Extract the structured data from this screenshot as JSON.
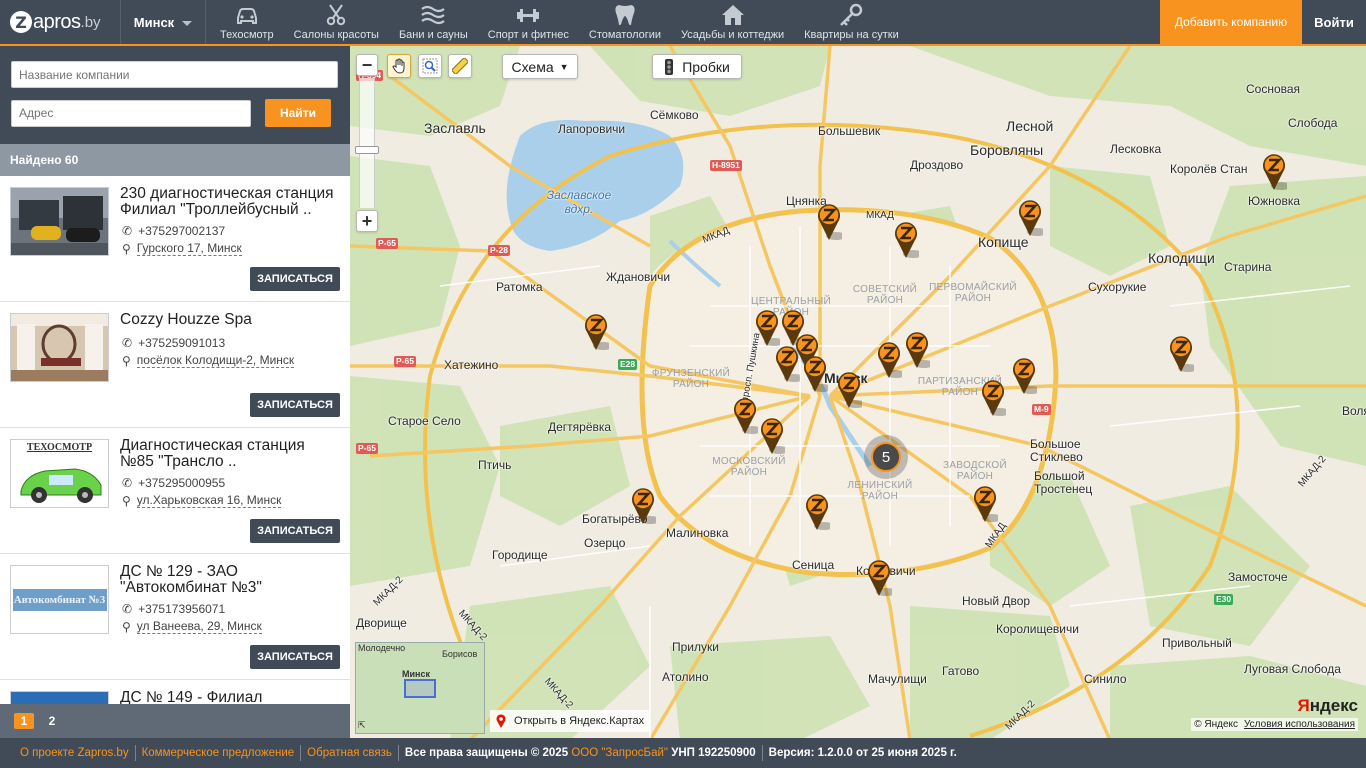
{
  "header": {
    "logo_text": "apros",
    "logo_letter": "Z",
    "logo_suffix": ".by",
    "city": "Минск",
    "categories": [
      {
        "label": "Техосмотр",
        "icon": "car-icon"
      },
      {
        "label": "Салоны красоты",
        "icon": "scissors-icon"
      },
      {
        "label": "Бани и сауны",
        "icon": "steam-icon"
      },
      {
        "label": "Спорт и фитнес",
        "icon": "dumbbell-icon"
      },
      {
        "label": "Стоматологии",
        "icon": "tooth-icon"
      },
      {
        "label": "Усадьбы и коттеджи",
        "icon": "house-icon"
      },
      {
        "label": "Квартиры на сутки",
        "icon": "key-icon"
      }
    ],
    "add_company": "Добавить компанию",
    "login": "Войти"
  },
  "search": {
    "name_placeholder": "Название компании",
    "address_placeholder": "Адрес",
    "find_label": "Найти"
  },
  "results": {
    "found_label": "Найдено 60",
    "items": [
      {
        "title": "230 диагностическая станция Филиал \"Троллейбусный ..",
        "phone": "+375297002137",
        "address": "Гурского 17, Минск",
        "button": "ЗАПИСАТЬСЯ",
        "thumb": "cars"
      },
      {
        "title": "Cozzy Houzze Spa",
        "phone": "+375259091013",
        "address": "посёлок Колодищи-2, Минск",
        "button": "ЗАПИСАТЬСЯ",
        "thumb": "room"
      },
      {
        "title": "Диагностическая станция №85 \"Трансло ..",
        "phone": "+375295000955",
        "address": "ул.Харьковская 16, Минск",
        "button": "ЗАПИСАТЬСЯ",
        "thumb": "techosmotr",
        "thumb_text": "ТЕХОСМОТР"
      },
      {
        "title": "ДС № 129 - ЗАО \"Автокомбинат №3\"",
        "phone": "+375173956071",
        "address": "ул Ванеева, 29, Минск",
        "button": "ЗАПИСАТЬСЯ",
        "thumb": "autokombinat",
        "thumb_text": "Автокомбинат №3"
      },
      {
        "title": "ДС № 149 - Филиал",
        "thumb": "blue"
      }
    ],
    "pages": [
      "1",
      "2"
    ],
    "active_page": "1"
  },
  "map": {
    "scheme_label": "Схема",
    "traffic_label": "Пробки",
    "open_yandex": "Открыть в Яндекс.Картах",
    "yandex_logo_y": "Я",
    "yandex_logo_rest": "ндекс",
    "copyright": "© Яндекс",
    "terms": "Условия использования",
    "cluster_count": "5",
    "minimap": {
      "label1": "Молодечно",
      "label2": "Борисов",
      "label3": "Минск"
    },
    "places": [
      {
        "name": "Заславль",
        "big": true
      },
      {
        "name": "Лапоровичи"
      },
      {
        "name": "Сёмково"
      },
      {
        "name": "Большевик"
      },
      {
        "name": "Лесной",
        "big": true
      },
      {
        "name": "Боровляны",
        "big": true
      },
      {
        "name": "Лесковка"
      },
      {
        "name": "Сосновая"
      },
      {
        "name": "Слобода"
      },
      {
        "name": "Королёв Стан"
      },
      {
        "name": "Южновка"
      },
      {
        "name": "Дроздово"
      },
      {
        "name": "Цнянка"
      },
      {
        "name": "Копище",
        "big": true
      },
      {
        "name": "Колодищи",
        "big": true
      },
      {
        "name": "Старина"
      },
      {
        "name": "Сухорукие"
      },
      {
        "name": "Ждановичи"
      },
      {
        "name": "Ратомка"
      },
      {
        "name": "Хатежино"
      },
      {
        "name": "Минск",
        "big": true
      },
      {
        "name": "Старое Село"
      },
      {
        "name": "Дегтярёвка"
      },
      {
        "name": "Птичь"
      },
      {
        "name": "Большое Стиклево"
      },
      {
        "name": "Большой Тростенец"
      },
      {
        "name": "Богатырёво"
      },
      {
        "name": "Малиновка"
      },
      {
        "name": "Озерцо"
      },
      {
        "name": "Городище"
      },
      {
        "name": "Сеница"
      },
      {
        "name": "Копиевичи"
      },
      {
        "name": "Новый Двор"
      },
      {
        "name": "Замосточе"
      },
      {
        "name": "Дворище"
      },
      {
        "name": "Королищевичи"
      },
      {
        "name": "Прилуки"
      },
      {
        "name": "Привольный"
      },
      {
        "name": "Атолино"
      },
      {
        "name": "Гатово"
      },
      {
        "name": "Мачулищи"
      },
      {
        "name": "Синило"
      },
      {
        "name": "Луговая Слобода"
      },
      {
        "name": "Воля"
      },
      {
        "name": "Заславское вдхр.",
        "water": true
      }
    ],
    "districts": [
      "ЦЕНТРАЛЬНЫЙ РАЙОН",
      "СОВЕТСКИЙ РАЙОН",
      "ПЕРВОМАЙСКИЙ РАЙОН",
      "ФРУНЗЕНСКИЙ РАЙОН",
      "ПАРТИЗАНСКИЙ РАЙОН",
      "МОСКОВСКИЙ РАЙОН",
      "ЛЕНИНСКИЙ РАЙОН",
      "ЗАВОДСКОЙ РАЙОН"
    ],
    "road_labels": [
      "H-894",
      "H-8951",
      "P-65",
      "P-28",
      "P-65",
      "E28",
      "M-9",
      "P-65",
      "E30",
      "МКАД",
      "МКАД",
      "МКАД",
      "МКАД-2",
      "МКАД-2",
      "МКАД-2",
      "МКАД-2",
      "МКАД-2",
      "просп. Пушкина"
    ]
  },
  "footer": {
    "about": "О проекте Zapros.by",
    "offer": "Коммерческое предложение",
    "feedback": "Обратная связь",
    "rights": "Все права защищены © 2025",
    "company": "ООО \"ЗапросБай\"",
    "unp": "УНП 192250900",
    "version": "Версия: 1.2.0.0 от 25 июня 2025 г."
  },
  "colors": {
    "accent": "#f7931e",
    "header": "#414b57"
  }
}
